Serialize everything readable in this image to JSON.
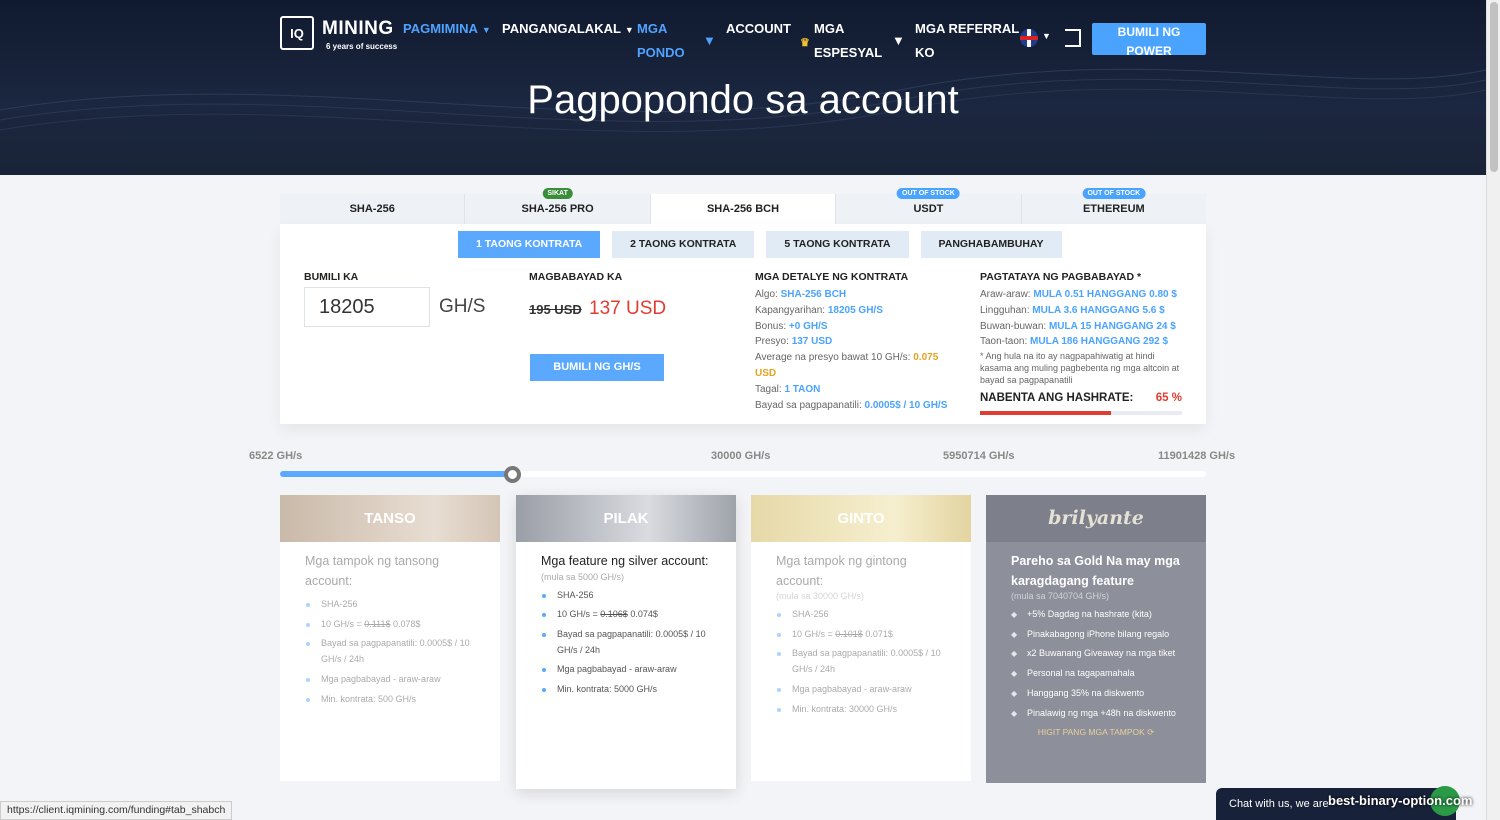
{
  "header": {
    "logo_brand": "MINING",
    "logo_chip": "IQ",
    "logo_tagline": "6 years of success",
    "nav": [
      {
        "label": "PAGMIMINA"
      },
      {
        "label": "PANGANGALAKAL"
      },
      {
        "label_line1": "MGA",
        "label_line2": "PONDO"
      },
      {
        "label": "ACCOUNT"
      },
      {
        "label_line1": "MGA",
        "label_line2": "ESPESYAL"
      },
      {
        "label_line1": "MGA REFERRAL",
        "label_line2": "KO"
      }
    ],
    "power_button_line1": "BUMILI NG",
    "power_button_line2": "POWER",
    "page_title": "Pagpopondo sa account"
  },
  "algo_tabs": [
    {
      "label": "SHA-256",
      "badge": ""
    },
    {
      "label": "SHA-256 PRO",
      "badge": "SIKAT"
    },
    {
      "label": "SHA-256 BCH",
      "badge": ""
    },
    {
      "label": "USDT",
      "badge": "OUT OF STOCK"
    },
    {
      "label": "ETHEREUM",
      "badge": "OUT OF STOCK"
    }
  ],
  "contract_tabs": [
    "1 TAONG KONTRATA",
    "2 TAONG KONTRATA",
    "5 TAONG KONTRATA",
    "PANGHABAMBUHAY"
  ],
  "purchase": {
    "buy_heading": "BUMILI KA",
    "amount_value": "18205",
    "unit": "GH/S",
    "pay_heading": "MAGBABAYAD KA",
    "old_price": "195 USD",
    "new_price": "137 USD",
    "buy_button": "BUMILI NG GH/S"
  },
  "details": {
    "heading": "MGA DETALYE NG KONTRATA",
    "algo_label": "Algo:",
    "algo_value": "SHA-256 BCH",
    "capacity_label": "Kapangyarihan:",
    "capacity_value": "18205 GH/S",
    "bonus_label": "Bonus:",
    "bonus_value": "+0 GH/S",
    "price_label": "Presyo:",
    "price_value": "137 USD",
    "avg_label": "Average na presyo bawat 10 GH/s:",
    "avg_value": "0.075 USD",
    "duration_label": "Tagal:",
    "duration_value": "1 TAON",
    "maint_label": "Bayad sa pagpapanatili:",
    "maint_value": "0.0005$ / 10 GH/S"
  },
  "estimate": {
    "heading": "PAGTATAYA NG PAGBABAYAD *",
    "daily_label": "Araw-araw:",
    "daily_value": "MULA 0.51 HANGGANG 0.80 $",
    "weekly_label": "Lingguhan:",
    "weekly_value": "MULA 3.6 HANGGANG 5.6 $",
    "monthly_label": "Buwan-buwan:",
    "monthly_value": "MULA 15 HANGGANG 24 $",
    "yearly_label": "Taon-taon:",
    "yearly_value": "MULA 186 HANGGANG 292 $",
    "note": "* Ang hula na ito ay nagpapahiwatig at hindi kasama ang muling pagbebenta ng mga altcoin at bayad sa pagpapanatili",
    "sold_label": "NABENTA ANG HASHRATE:",
    "sold_pct_text": "65 %",
    "sold_fraction": 0.65
  },
  "slider": {
    "ticks": [
      "6522 GH/s",
      "30000 GH/s",
      "5950714 GH/s",
      "11901428 GH/s"
    ],
    "fill_fraction": 0.25
  },
  "cards": {
    "bronze": {
      "name": "TANSO",
      "title": "Mga tampok ng tansong account:",
      "items": [
        "SHA-256",
        "Bayad sa pagpapanatili: 0.0005$ / 10 GH/s / 24h",
        "Mga pagbabayad - araw-araw",
        "Min. kontrata: 500 GH/s"
      ],
      "rate_prefix": "10 GH/s = ",
      "rate_old": "0.111$",
      "rate_new": " 0.078$"
    },
    "silver": {
      "name": "PILAK",
      "title": "Mga feature ng silver account:",
      "sub": "(mula sa 5000 GH/s)",
      "items": [
        "SHA-256",
        "Bayad sa pagpapanatili: 0.0005$ / 10 GH/s / 24h",
        "Mga pagbabayad - araw-araw",
        "Min. kontrata: 5000 GH/s"
      ],
      "rate_prefix": "10 GH/s = ",
      "rate_old": "0.106$",
      "rate_new": " 0.074$"
    },
    "gold": {
      "name": "GINTO",
      "title": "Mga tampok ng gintong account:",
      "sub": "(mula sa 30000 GH/s)",
      "items": [
        "SHA-256",
        "Bayad sa pagpapanatili: 0.0005$ / 10 GH/s / 24h",
        "Mga pagbabayad - araw-araw",
        "Min. kontrata: 30000 GH/s"
      ],
      "rate_prefix": "10 GH/s = ",
      "rate_old": "0.101$",
      "rate_new": " 0.071$"
    },
    "brilliant": {
      "name": "brilyante",
      "title": "Pareho sa Gold Na may mga karagdagang feature",
      "sub": "(mula sa 7040704 GH/s)",
      "items": [
        "+5% Dagdag na hashrate (kita)",
        "Pinakabagong iPhone bilang regalo",
        "x2 Buwanang Giveaway na mga tiket",
        "Personal na tagapamahala",
        "Hanggang 35% na diskwento",
        "Pinalawig ng mga +48h na diskwento"
      ],
      "more": "HIGIT PANG MGA TAMPOK"
    }
  },
  "status_url": "https://client.iqmining.com/funding#tab_shabch",
  "chat_text": "Chat with us, we are",
  "watermark": "best-binary-option.com"
}
